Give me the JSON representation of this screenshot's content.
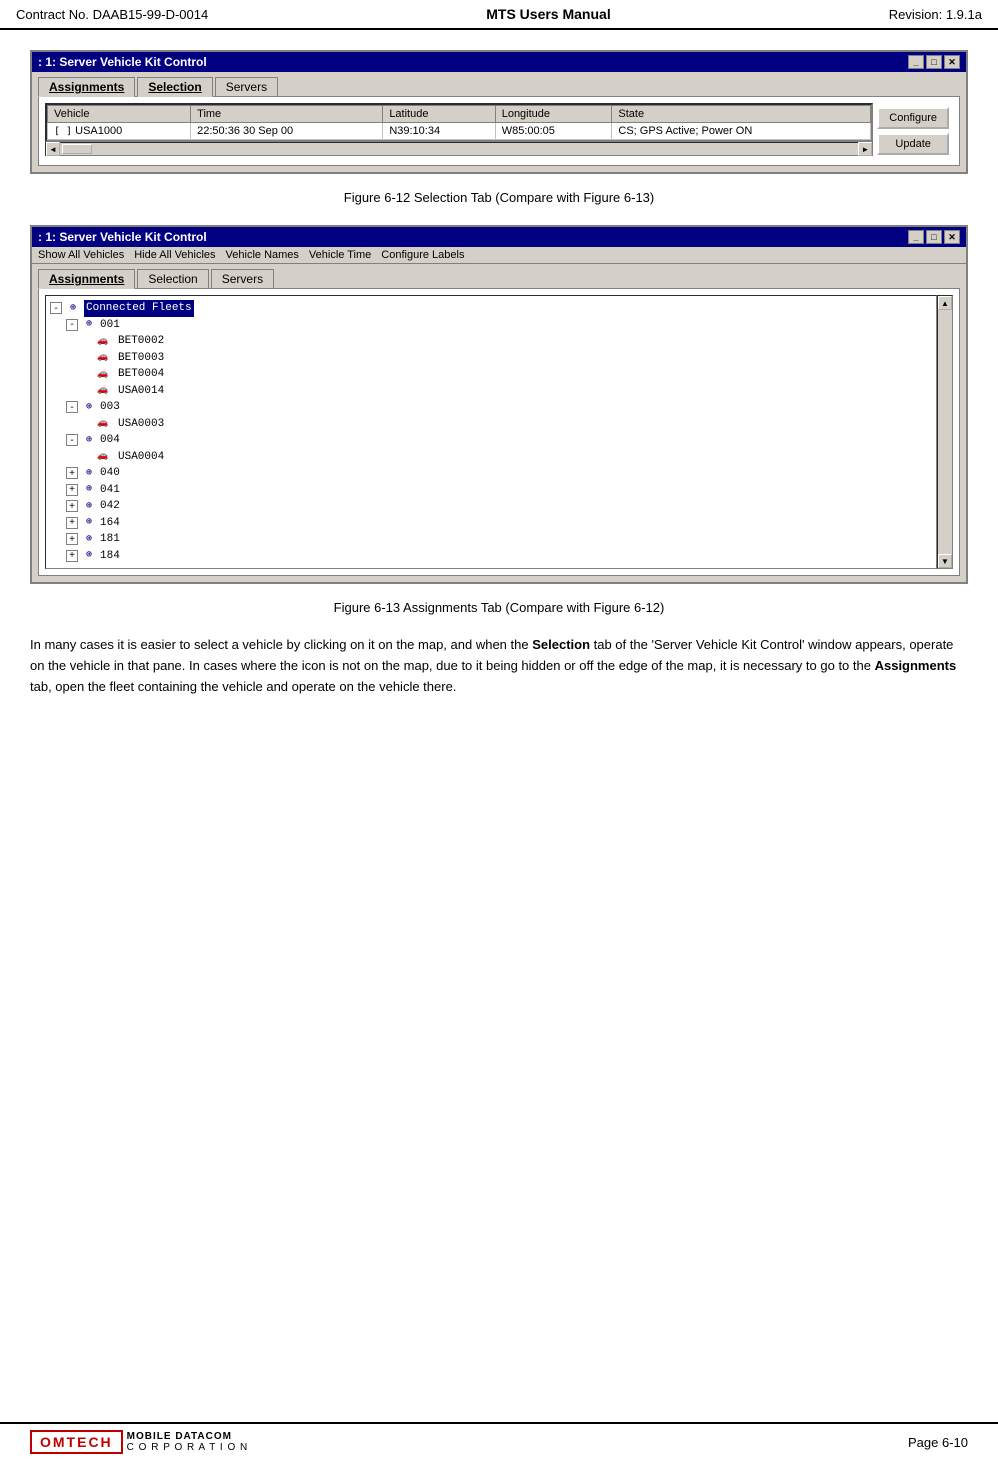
{
  "header": {
    "left": "Contract No. DAAB15-99-D-0014",
    "center": "MTS Users Manual",
    "right": "Revision:  1.9.1a"
  },
  "figure1": {
    "window_title": ": 1: Server Vehicle Kit Control",
    "tabs": [
      "Assignments",
      "Selection",
      "Servers"
    ],
    "active_tab": "Selection",
    "table": {
      "columns": [
        "Vehicle",
        "Time",
        "Latitude",
        "Longitude",
        "State"
      ],
      "rows": [
        [
          "USA1000",
          "22:50:36 30 Sep 00",
          "N39:10:34",
          "W85:00:05",
          "CS; GPS Active; Power ON"
        ]
      ]
    },
    "buttons": [
      "Configure",
      "Update"
    ],
    "caption": "Figure 6-12   Selection Tab (Compare with Figure 6-13)"
  },
  "figure2": {
    "window_title": ": 1: Server Vehicle Kit Control",
    "menu_items": [
      "Show All Vehicles",
      "Hide All Vehicles",
      "Vehicle Names",
      "Vehicle Time",
      "Configure Labels"
    ],
    "tabs": [
      "Assignments",
      "Selection",
      "Servers"
    ],
    "active_tab": "Assignments",
    "tree": {
      "root": "Connected Fleets",
      "items": [
        {
          "id": "001",
          "type": "fleet",
          "expanded": true,
          "children": [
            {
              "id": "BET0002",
              "type": "vehicle"
            },
            {
              "id": "BET0003",
              "type": "vehicle"
            },
            {
              "id": "BET0004",
              "type": "vehicle"
            },
            {
              "id": "USA0014",
              "type": "vehicle"
            }
          ]
        },
        {
          "id": "003",
          "type": "fleet",
          "expanded": true,
          "children": [
            {
              "id": "USA0003",
              "type": "vehicle"
            }
          ]
        },
        {
          "id": "004",
          "type": "fleet",
          "expanded": true,
          "children": [
            {
              "id": "USA0004",
              "type": "vehicle"
            }
          ]
        },
        {
          "id": "040",
          "type": "fleet",
          "expanded": false,
          "children": []
        },
        {
          "id": "041",
          "type": "fleet",
          "expanded": false,
          "children": []
        },
        {
          "id": "042",
          "type": "fleet",
          "expanded": false,
          "children": []
        },
        {
          "id": "164",
          "type": "fleet",
          "expanded": false,
          "children": []
        },
        {
          "id": "181",
          "type": "fleet",
          "expanded": false,
          "children": []
        },
        {
          "id": "184",
          "type": "fleet",
          "expanded": false,
          "children": []
        }
      ]
    },
    "caption": "Figure 6-13   Assignments Tab (Compare with Figure 6-12)"
  },
  "body_paragraph": "In many cases it is easier to select a vehicle by clicking on it on the map, and when the Selection tab of the ‘Server Vehicle Kit Control’ window appears, operate on the vehicle in that pane.  In cases where the icon is not on the map, due to it being hidden or off the edge of the map, it is necessary to go to the Assignments tab, open the fleet containing the vehicle and operate on the vehicle there.",
  "body_bold_1": "Selection",
  "body_bold_2": "Assignments",
  "footer": {
    "logo_text": "OMTECH",
    "sub_text": "MOBILE DATACOM",
    "corp_text": "C O R P O R A T I O N",
    "page": "Page 6-10"
  }
}
